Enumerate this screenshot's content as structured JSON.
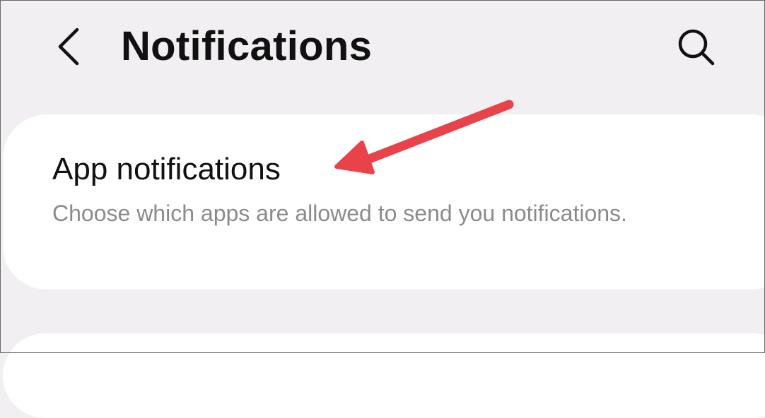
{
  "header": {
    "title": "Notifications",
    "back_icon": "chevron-left-icon",
    "search_icon": "search-icon"
  },
  "card": {
    "title": "App notifications",
    "description": "Choose which apps are allowed to send you notifications."
  },
  "annotation": {
    "arrow_color": "#e8434b"
  },
  "colors": {
    "background": "#f2eff2",
    "card": "#ffffff",
    "title_text": "#111111",
    "description_text": "#8b8b8b"
  }
}
